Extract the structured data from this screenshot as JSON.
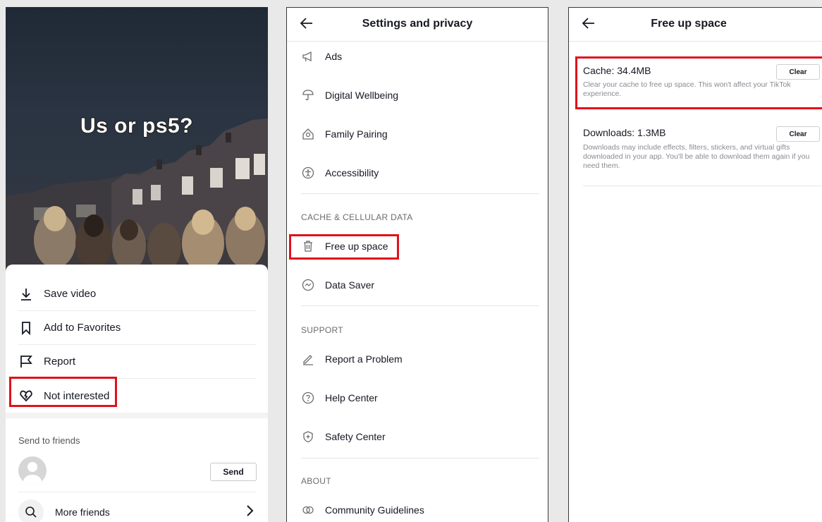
{
  "panel1": {
    "caption": "Us or ps5?",
    "menu": [
      {
        "label": "Save video",
        "icon": "download-icon"
      },
      {
        "label": "Add to Favorites",
        "icon": "bookmark-icon"
      },
      {
        "label": "Report",
        "icon": "flag-icon"
      },
      {
        "label": "Not interested",
        "icon": "broken-heart-icon"
      }
    ],
    "send_to_friends": "Send to friends",
    "send_button": "Send",
    "more_friends": "More friends"
  },
  "panel2": {
    "title": "Settings and privacy",
    "items_top": [
      {
        "label": "Ads",
        "icon": "megaphone-icon"
      },
      {
        "label": "Digital Wellbeing",
        "icon": "umbrella-icon"
      },
      {
        "label": "Family Pairing",
        "icon": "house-icon"
      },
      {
        "label": "Accessibility",
        "icon": "accessibility-icon"
      }
    ],
    "section_cache": "CACHE & CELLULAR DATA",
    "items_cache": [
      {
        "label": "Free up space",
        "icon": "trash-icon"
      },
      {
        "label": "Data Saver",
        "icon": "data-saver-icon"
      }
    ],
    "section_support": "SUPPORT",
    "items_support": [
      {
        "label": "Report a Problem",
        "icon": "pencil-icon"
      },
      {
        "label": "Help Center",
        "icon": "help-icon"
      },
      {
        "label": "Safety Center",
        "icon": "shield-icon"
      }
    ],
    "section_about": "ABOUT",
    "items_about": [
      {
        "label": "Community Guidelines",
        "icon": "rings-icon"
      }
    ]
  },
  "panel3": {
    "title": "Free up space",
    "cache_label": "Cache: 34.4MB",
    "cache_desc": "Clear your cache to free up space. This won't affect your TikTok experience.",
    "downloads_label": "Downloads: 1.3MB",
    "downloads_desc": "Downloads may include effects, filters, stickers, and virtual gifts downloaded in your app. You'll be able to download them again if you need them.",
    "clear_label": "Clear"
  },
  "colors": {
    "highlight": "#e1111b",
    "background": "#e9e9e9"
  }
}
